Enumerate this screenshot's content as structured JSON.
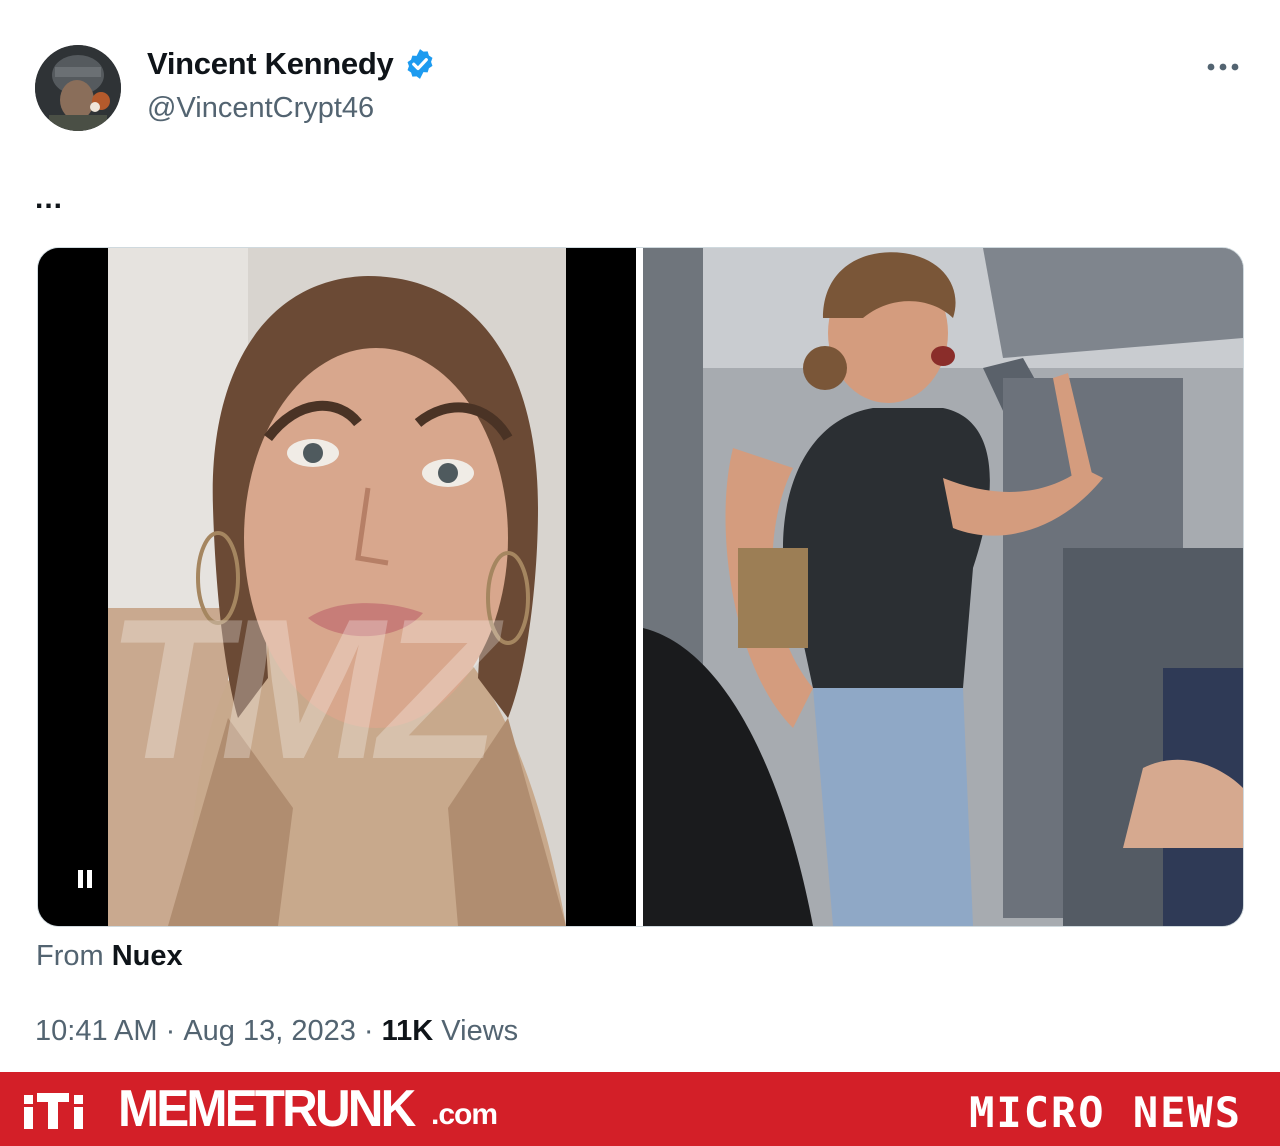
{
  "tweet": {
    "author": {
      "display_name": "Vincent Kennedy",
      "handle": "@VincentCrypt46",
      "verified": true,
      "verified_color": "#1d9bf0"
    },
    "more_icon": "more-horizontal-icon",
    "text": "...",
    "media": {
      "left_video_icon": "pause-icon",
      "panels": 2
    },
    "source_prefix": "From",
    "source_name": "Nuex",
    "time": "10:41 AM",
    "separator": " · ",
    "date": "Aug 13, 2023",
    "views_count": "11K",
    "views_label": " Views"
  },
  "banner": {
    "brand_name": "MEMETRUNK",
    "brand_tld": ".com",
    "right_label": "MICRO NEWS",
    "background_color": "#d31f28"
  }
}
